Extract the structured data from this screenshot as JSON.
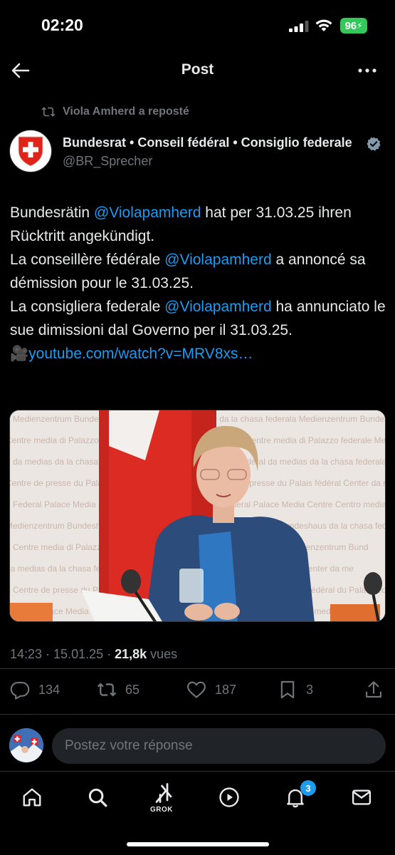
{
  "status_bar": {
    "time": "02:20",
    "battery": "96"
  },
  "header": {
    "title": "Post"
  },
  "repost": {
    "text": "Viola Amherd a reposté"
  },
  "author": {
    "name": "Bundesrat • Conseil fédéral • Consiglio federale",
    "handle": "@BR_Sprecher"
  },
  "tweet": {
    "line1_pre": "Bundesrätin ",
    "mention1": "@Violapamherd",
    "line1_post": " hat per 31.03.25 ihren Rücktritt angekündigt.",
    "line2_pre": "La conseillère fédérale ",
    "mention2": "@Violapamherd",
    "line2_post": " a annoncé sa démission pour le 31.03.25.",
    "line3_pre": "La consigliera federale ",
    "mention3": "@Violapamherd",
    "line3_post": " ha annunciato le sue dimissioni dal Governo per il 31.03.25.",
    "link_emoji": "🎥",
    "link": "youtube.com/watch?v=MRV8xs…"
  },
  "media": {
    "wall_lines": [
      "Medienzentrum Bundeshaus  Centre media di Palazzo  da la chasa federala",
      "Centre media di Palazzo federale  Medienzentrum Bundeshaus",
      "da medias da la chasa federala  Centre de presse du Palais fédéral",
      "Centre de presse du Palais fédéral  Center da medias",
      "Federal Palace Media Centre  Centro media di Palazzo",
      "Medienzentrum Bundeshaus  da la chasa federala  Fede",
      "Centre media di Palazzo  Medienzentrum Bund",
      "da medias da la chasa federala  Center da me",
      "Centre de presse du Palais fédéral  du Palais fédé",
      "Federal Palace Media Centre  Centro media"
    ]
  },
  "meta": {
    "time": "14:23 · 15.01.25 · ",
    "views": "21,8k",
    "views_label": " vues"
  },
  "actions": {
    "replies": "134",
    "reposts": "65",
    "likes": "187",
    "bookmarks": "3"
  },
  "reply": {
    "placeholder": "Postez votre réponse"
  },
  "nav": {
    "grok_label": "GROK",
    "notifications_badge": "3"
  }
}
